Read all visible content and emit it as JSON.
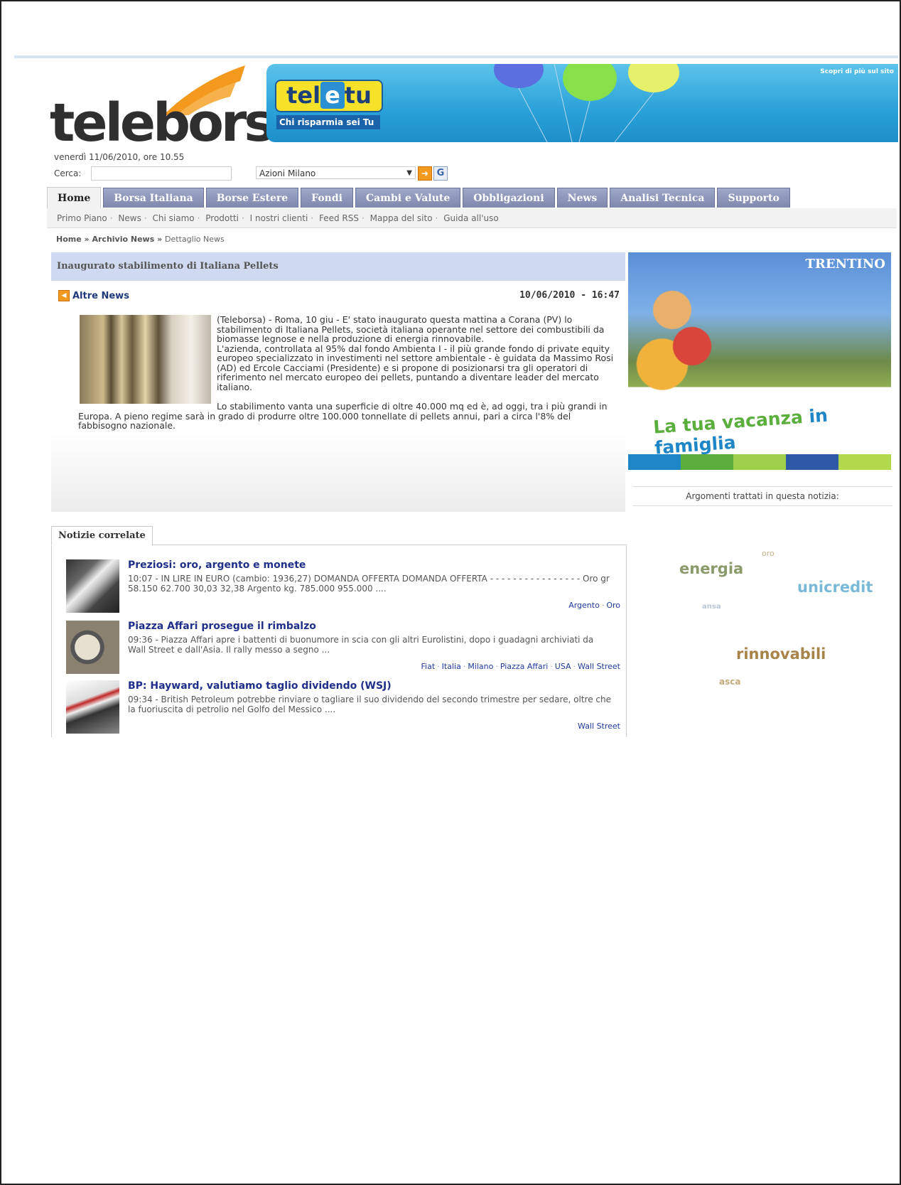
{
  "header": {
    "logo": "teleborsa",
    "banner_brand_left": "tel",
    "banner_brand_mid": "e",
    "banner_brand_right": "tu",
    "banner_tagline": "Chi risparmia sei Tu",
    "banner_corner": "Scopri di più sul sito",
    "date_line": "venerdì 11/06/2010, ore 10.55",
    "search_label": "Cerca:",
    "search_value": "",
    "select_value": "Azioni Milano"
  },
  "tabs": [
    {
      "label": "Home",
      "active": true
    },
    {
      "label": "Borsa Italiana"
    },
    {
      "label": "Borse Estere"
    },
    {
      "label": "Fondi"
    },
    {
      "label": "Cambi e Valute"
    },
    {
      "label": "Obbligazioni"
    },
    {
      "label": "News"
    },
    {
      "label": "Analisi Tecnica"
    },
    {
      "label": "Supporto"
    }
  ],
  "subnav": [
    "Primo Piano",
    "News",
    "Chi siamo",
    "Prodotti",
    "I nostri clienti",
    "Feed RSS",
    "Mappa del sito",
    "Guida all'uso"
  ],
  "subnav_sep": "·",
  "breadcrumb": {
    "home": "Home",
    "sep": "»",
    "archive": "Archivio News",
    "current": "Dettaglio News"
  },
  "article": {
    "title": "Inaugurato stabilimento di Italiana Pellets",
    "altre_news": "Altre News",
    "date": "10/06/2010 - 16:47",
    "paragraph1": "(Teleborsa) - Roma, 10 giu - E' stato inaugurato questa mattina a Corana (PV) lo stabilimento di Italiana Pellets, società italiana operante nel settore dei combustibili da biomasse legnose e nella produzione di energia rinnovabile.",
    "paragraph2": "L'azienda, controllata al 95% dal fondo Ambienta I - il più grande fondo di private equity europeo specializzato in investimenti nel settore ambientale - è guidata da Massimo Rosi (AD) ed Ercole Cacciami (Presidente) e si propone di posizionarsi tra gli operatori di riferimento nel mercato europeo dei pellets, puntando a diventare leader del mercato italiano.",
    "paragraph3": "Lo stabilimento vanta una superficie di oltre 40.000 mq ed è, ad oggi, tra i più grandi in Europa. A pieno regime sarà in grado di produrre oltre 100.000 tonnellate di pellets annui, pari a circa l'8% del fabbisogno nazionale."
  },
  "ad": {
    "brand": "TRENTINO",
    "slogan_green": "La tua vacanza ",
    "slogan_blue": "in famiglia"
  },
  "topics_label": "Argomenti trattati in questa notizia:",
  "tagcloud": [
    {
      "text": "energia",
      "color": "#8a9a6a"
    },
    {
      "text": "oro",
      "color": "#c4b28a"
    },
    {
      "text": "unicredit",
      "color": "#7ab8d8"
    },
    {
      "text": "ansa",
      "color": "#b8c8d8"
    },
    {
      "text": "rinnovabili",
      "color": "#a8844a"
    },
    {
      "text": "asca",
      "color": "#c4a878"
    }
  ],
  "related": {
    "tab_label": "Notizie correlate",
    "items": [
      {
        "title": "Preziosi: oro, argento e monete",
        "snippet": "10:07 - IN LIRE IN EURO (cambio: 1936,27) DOMANDA OFFERTA DOMANDA OFFERTA - - - - - - - - - - - - - - - - Oro gr 58.150 62.700 30,03 32,38 Argento kg. 785.000 955.000 ....",
        "tags": [
          "Argento",
          "Oro"
        ]
      },
      {
        "title": "Piazza Affari prosegue il rimbalzo",
        "snippet": "09:36 - Piazza Affari apre i battenti di buonumore in scia con gli altri Eurolistini, dopo i guadagni archiviati da Wall Street e dall'Asia. Il rally messo a segno ...",
        "tags": [
          "Fiat",
          "Italia",
          "Milano",
          "Piazza Affari",
          "USA",
          "Wall Street"
        ]
      },
      {
        "title": "BP: Hayward, valutiamo taglio dividendo (WSJ)",
        "snippet": "09:34 - British Petroleum potrebbe rinviare o tagliare il suo dividendo del secondo trimestre per sedare, oltre che la fuoriuscita di petrolio nel Golfo del Messico ....",
        "tags": [
          "Wall Street"
        ]
      }
    ]
  }
}
